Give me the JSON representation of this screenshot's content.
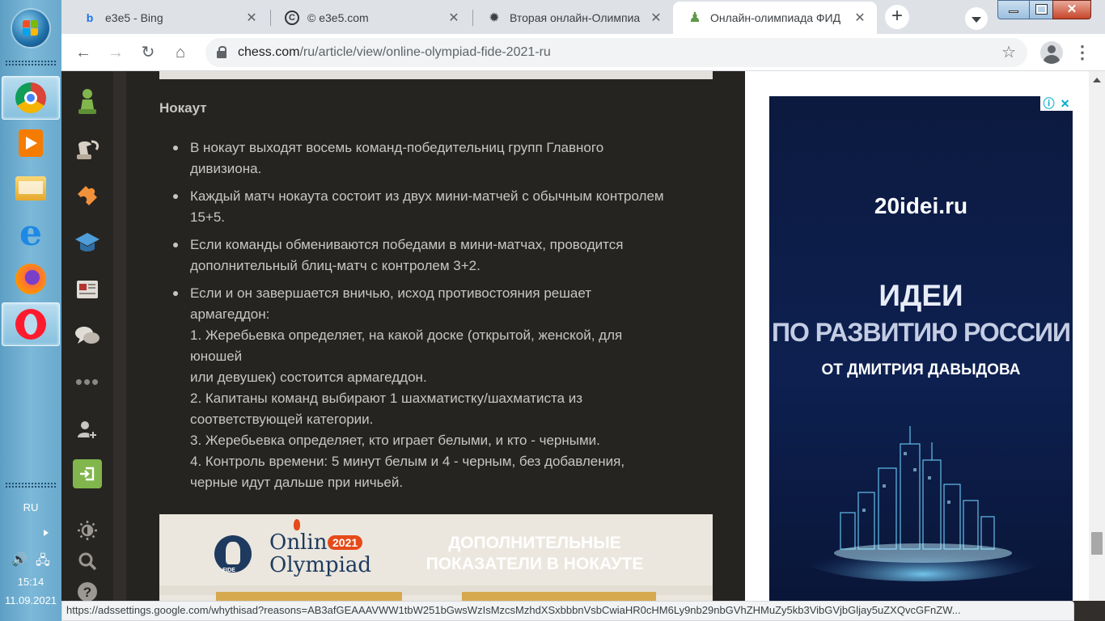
{
  "taskbar": {
    "apps": [
      {
        "name": "chrome",
        "color": "#db4437"
      },
      {
        "name": "media-player",
        "color": "#f57c00"
      },
      {
        "name": "file-explorer",
        "color": "#f2c14e"
      },
      {
        "name": "internet-explorer",
        "color": "#1e88e5"
      },
      {
        "name": "firefox",
        "color": "#ff7139"
      },
      {
        "name": "opera",
        "color": "#ff1b2d"
      }
    ],
    "language": "RU",
    "time": "15:14",
    "date": "11.09.2021"
  },
  "browser": {
    "tabs": [
      {
        "title": "e3e5 - Bing",
        "favicon": "bing-icon"
      },
      {
        "title": "© e3e5.com",
        "favicon": "e3e5-icon"
      },
      {
        "title": "Вторая онлайн-Олимпиа",
        "favicon": "fide-icon"
      },
      {
        "title": "Онлайн-олимпиада ФИД",
        "favicon": "chess-pawn-icon",
        "active": true
      }
    ],
    "url_host": "chess.com",
    "url_path": "/ru/article/view/online-olympiad-fide-2021-ru"
  },
  "article": {
    "heading": "Нокаут",
    "bullets": [
      {
        "lines": [
          "В нокаут выходят восемь команд-победительниц групп Главного",
          "дивизиона."
        ]
      },
      {
        "lines": [
          "Каждый матч нокаута состоит из двух мини-матчей с обычным контролем",
          "15+5."
        ]
      },
      {
        "lines": [
          "Если команды обмениваются победами в мини-матчах, проводится",
          "дополнительный блиц-матч с контролем 3+2."
        ]
      },
      {
        "lines": [
          "Если и он завершается вничью, исход противостояния решает",
          "армагеддон:",
          "1. Жеребьевка определяет, на какой доске (открытой, женской, для",
          "юношей",
          "или девушек) состоится армагеддон.",
          "2. Капитаны команд выбирают 1 шахматистку/шахматиста из",
          "соответствующей категории.",
          "3. Жеребьевка определяет, кто играет белыми, и кто - черными.",
          "4. Контроль времени: 5 минут белым и 4 - черным, без добавления,",
          "черные идут дальше при ничьей."
        ]
      }
    ],
    "promo": {
      "logo_line1": "Online",
      "logo_year": "2021",
      "logo_line2": "Olympiad",
      "logo_small": "FIDE",
      "title_line1": "ДОПОЛНИТЕЛЬНЫЕ",
      "title_line2": "ПОКАЗАТЕЛИ В НОКАУТЕ"
    }
  },
  "ad": {
    "site": "20idei.ru",
    "line1": "ИДЕИ",
    "line2": "ПО РАЗВИТИЮ РОССИИ",
    "line3": "ОТ ДМИТРИЯ ДАВЫДОВА"
  },
  "status_url": "https://adssettings.google.com/whythisad?reasons=AB3afGEAAAVWW1tbW251bGwsWzIsMzcsMzhdXSxbbbnVsbCwiaHR0cHM6Ly9nb29nbGVhZHMuZy5kb3VibGVjbGljay5uZXQvcGFnZW..."
}
